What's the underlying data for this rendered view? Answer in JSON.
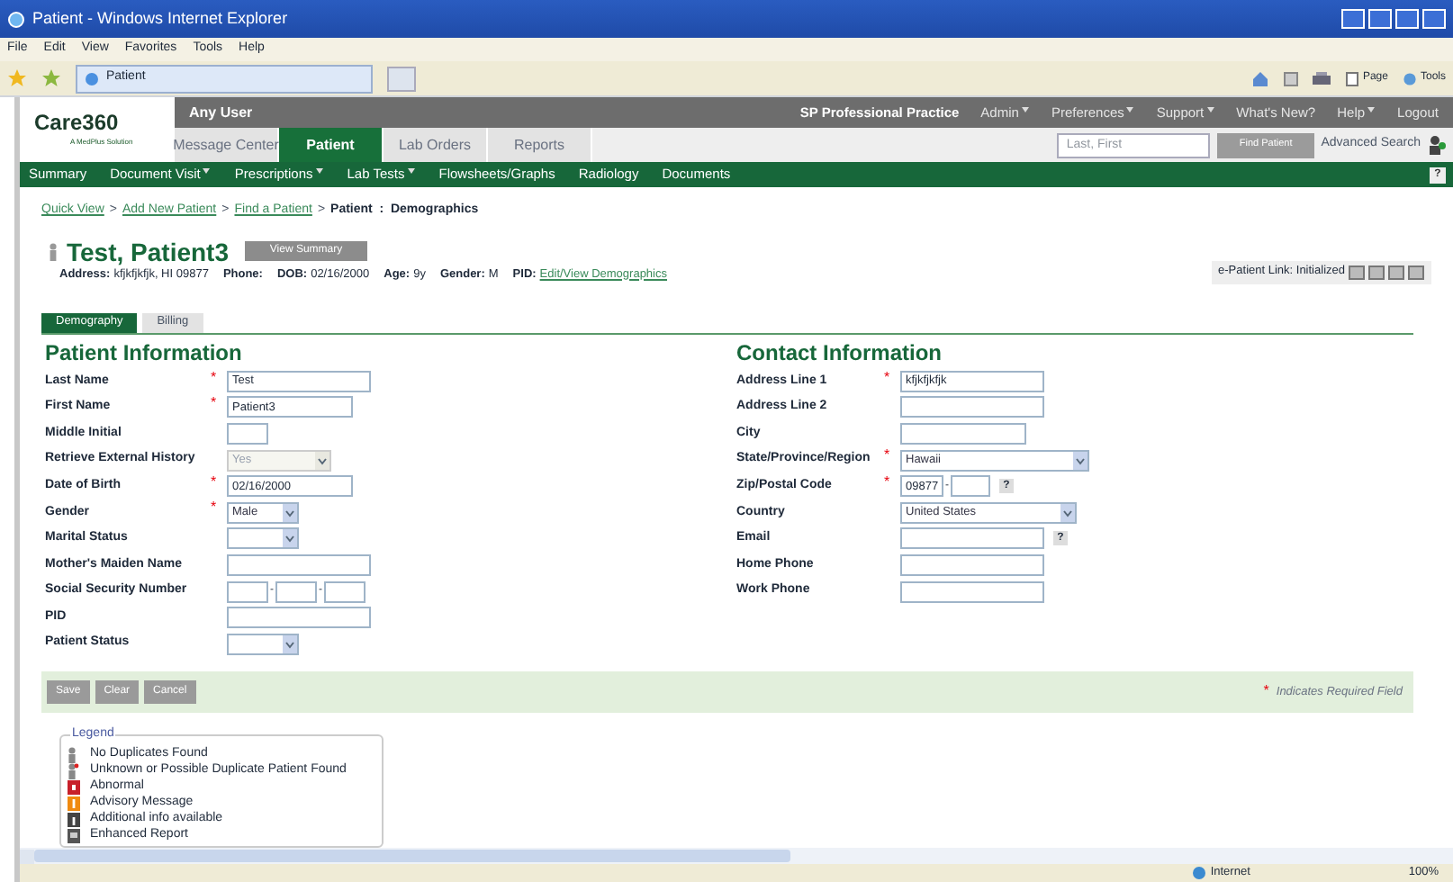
{
  "window": {
    "title": "Patient - Windows Internet Explorer"
  },
  "menu": [
    "File",
    "Edit",
    "View",
    "Favorites",
    "Tools",
    "Help"
  ],
  "browser_tab": {
    "title": "Patient"
  },
  "browser_toolbar": [
    "Page",
    "Tools"
  ],
  "header": {
    "user": "Any User",
    "practice": "SP Professional Practice",
    "links": [
      {
        "label": "Admin",
        "dropdown": true
      },
      {
        "label": "Preferences",
        "dropdown": true
      },
      {
        "label": "Support",
        "dropdown": true
      },
      {
        "label": "What's New?",
        "dropdown": false
      },
      {
        "label": "Help",
        "dropdown": true
      },
      {
        "label": "Logout",
        "dropdown": false
      }
    ],
    "logo": {
      "name": "Care360",
      "tagline": "A MedPlus Solution"
    },
    "tabs": [
      {
        "label": "Message Center",
        "selected": false
      },
      {
        "label": "Patient",
        "selected": true
      },
      {
        "label": "Lab Orders",
        "selected": false
      },
      {
        "label": "Reports",
        "selected": false
      }
    ],
    "search": {
      "placeholder": "Last, First",
      "button": "Find Patient",
      "advanced": "Advanced Search"
    }
  },
  "nav": [
    {
      "label": "Summary",
      "dropdown": false
    },
    {
      "label": "Document Visit",
      "dropdown": true
    },
    {
      "label": "Prescriptions",
      "dropdown": true
    },
    {
      "label": "Lab Tests",
      "dropdown": true
    },
    {
      "label": "Flowsheets/Graphs",
      "dropdown": false
    },
    {
      "label": "Radiology",
      "dropdown": false
    },
    {
      "label": "Documents",
      "dropdown": false
    }
  ],
  "nav_help": "?",
  "breadcrumb": [
    {
      "label": "Quick View",
      "kind": "link"
    },
    {
      "label": ">",
      "kind": "separator"
    },
    {
      "label": "Add New Patient",
      "kind": "link"
    },
    {
      "label": ">",
      "kind": "separator"
    },
    {
      "label": "Find a Patient",
      "kind": "link"
    },
    {
      "label": ">",
      "kind": "separator"
    },
    {
      "label": "Patient  :  Demographics",
      "kind": "current"
    }
  ],
  "patient": {
    "name": "Test, Patient3",
    "summary_button": "View Summary",
    "details": [
      {
        "label": "Address:",
        "value": "kfjkfjkfjk, HI 09877"
      },
      {
        "label": "Phone:"
      },
      {
        "label": "DOB:",
        "value": "02/16/2000"
      },
      {
        "label": "Age:",
        "value": "9y"
      },
      {
        "label": "Gender:",
        "value": "M"
      },
      {
        "label": "PID:",
        "link": "Edit/View Demographics"
      }
    ],
    "epatient": "e-Patient Link: Initialized"
  },
  "form_tabs": [
    {
      "label": "Demography",
      "selected": true
    },
    {
      "label": "Billing",
      "selected": false
    }
  ],
  "patient_info": {
    "title": "Patient Information",
    "fields": [
      {
        "label": "Last Name",
        "required": true,
        "kind": "text",
        "value": "Test"
      },
      {
        "label": "First Name",
        "required": true,
        "kind": "date",
        "value": "Patient3"
      },
      {
        "label": "Middle Initial",
        "required": false,
        "kind": "initial"
      },
      {
        "label": "Retrieve External History",
        "required": false,
        "kind": "select",
        "value": "Yes",
        "disabled": true
      },
      {
        "label": "Date of Birth",
        "required": true,
        "kind": "date",
        "value": "02/16/2000"
      },
      {
        "label": "Gender",
        "required": true,
        "kind": "select",
        "value": "Male",
        "disabled": false
      },
      {
        "label": "Marital Status",
        "required": false,
        "kind": "select",
        "disabled": false
      },
      {
        "label": "Mother's Maiden Name",
        "required": false,
        "kind": "text"
      },
      {
        "label": "Social Security Number",
        "required": false,
        "kind": "ssn",
        "separator": "-"
      },
      {
        "label": "PID",
        "required": false,
        "kind": "text"
      },
      {
        "label": "Patient Status",
        "required": false,
        "kind": "select",
        "disabled": false
      }
    ]
  },
  "contact_info": {
    "title": "Contact Information",
    "fields": [
      {
        "label": "Address Line 1",
        "required": true,
        "kind": "text",
        "value": "kfjkfjkfjk"
      },
      {
        "label": "Address Line 2",
        "required": false,
        "kind": "text"
      },
      {
        "label": "City",
        "required": false,
        "kind": "date"
      },
      {
        "label": "State/Province/Region",
        "required": true,
        "kind": "wideselect",
        "value": "Hawaii",
        "disabled": false
      },
      {
        "label": "Zip/Postal Code",
        "required": true,
        "kind": "zip",
        "value": "09877",
        "separator": "-",
        "help": "?"
      },
      {
        "label": "Country",
        "required": false,
        "kind": "wideselect",
        "value": "United States",
        "disabled": false
      },
      {
        "label": "Email",
        "required": false,
        "kind": "text",
        "help": "?"
      },
      {
        "label": "Home Phone",
        "required": false,
        "kind": "text"
      },
      {
        "label": "Work Phone",
        "required": false,
        "kind": "text"
      }
    ]
  },
  "actions": [
    "Save",
    "Clear",
    "Cancel"
  ],
  "required_note": {
    "mark": "*",
    "text": "Indicates Required Field"
  },
  "legend": {
    "title": "Legend",
    "items": [
      {
        "kind": "person",
        "label": "No Duplicates Found"
      },
      {
        "kind": "person_flag",
        "label": "Unknown or Possible Duplicate Patient Found"
      },
      {
        "kind": "abnormal",
        "label": "Abnormal"
      },
      {
        "kind": "advisory",
        "label": "Advisory Message"
      },
      {
        "kind": "info",
        "label": "Additional info available"
      },
      {
        "kind": "report",
        "label": "Enhanced Report"
      }
    ]
  },
  "status_bar": {
    "zone": "Internet",
    "zoom": "100%"
  }
}
